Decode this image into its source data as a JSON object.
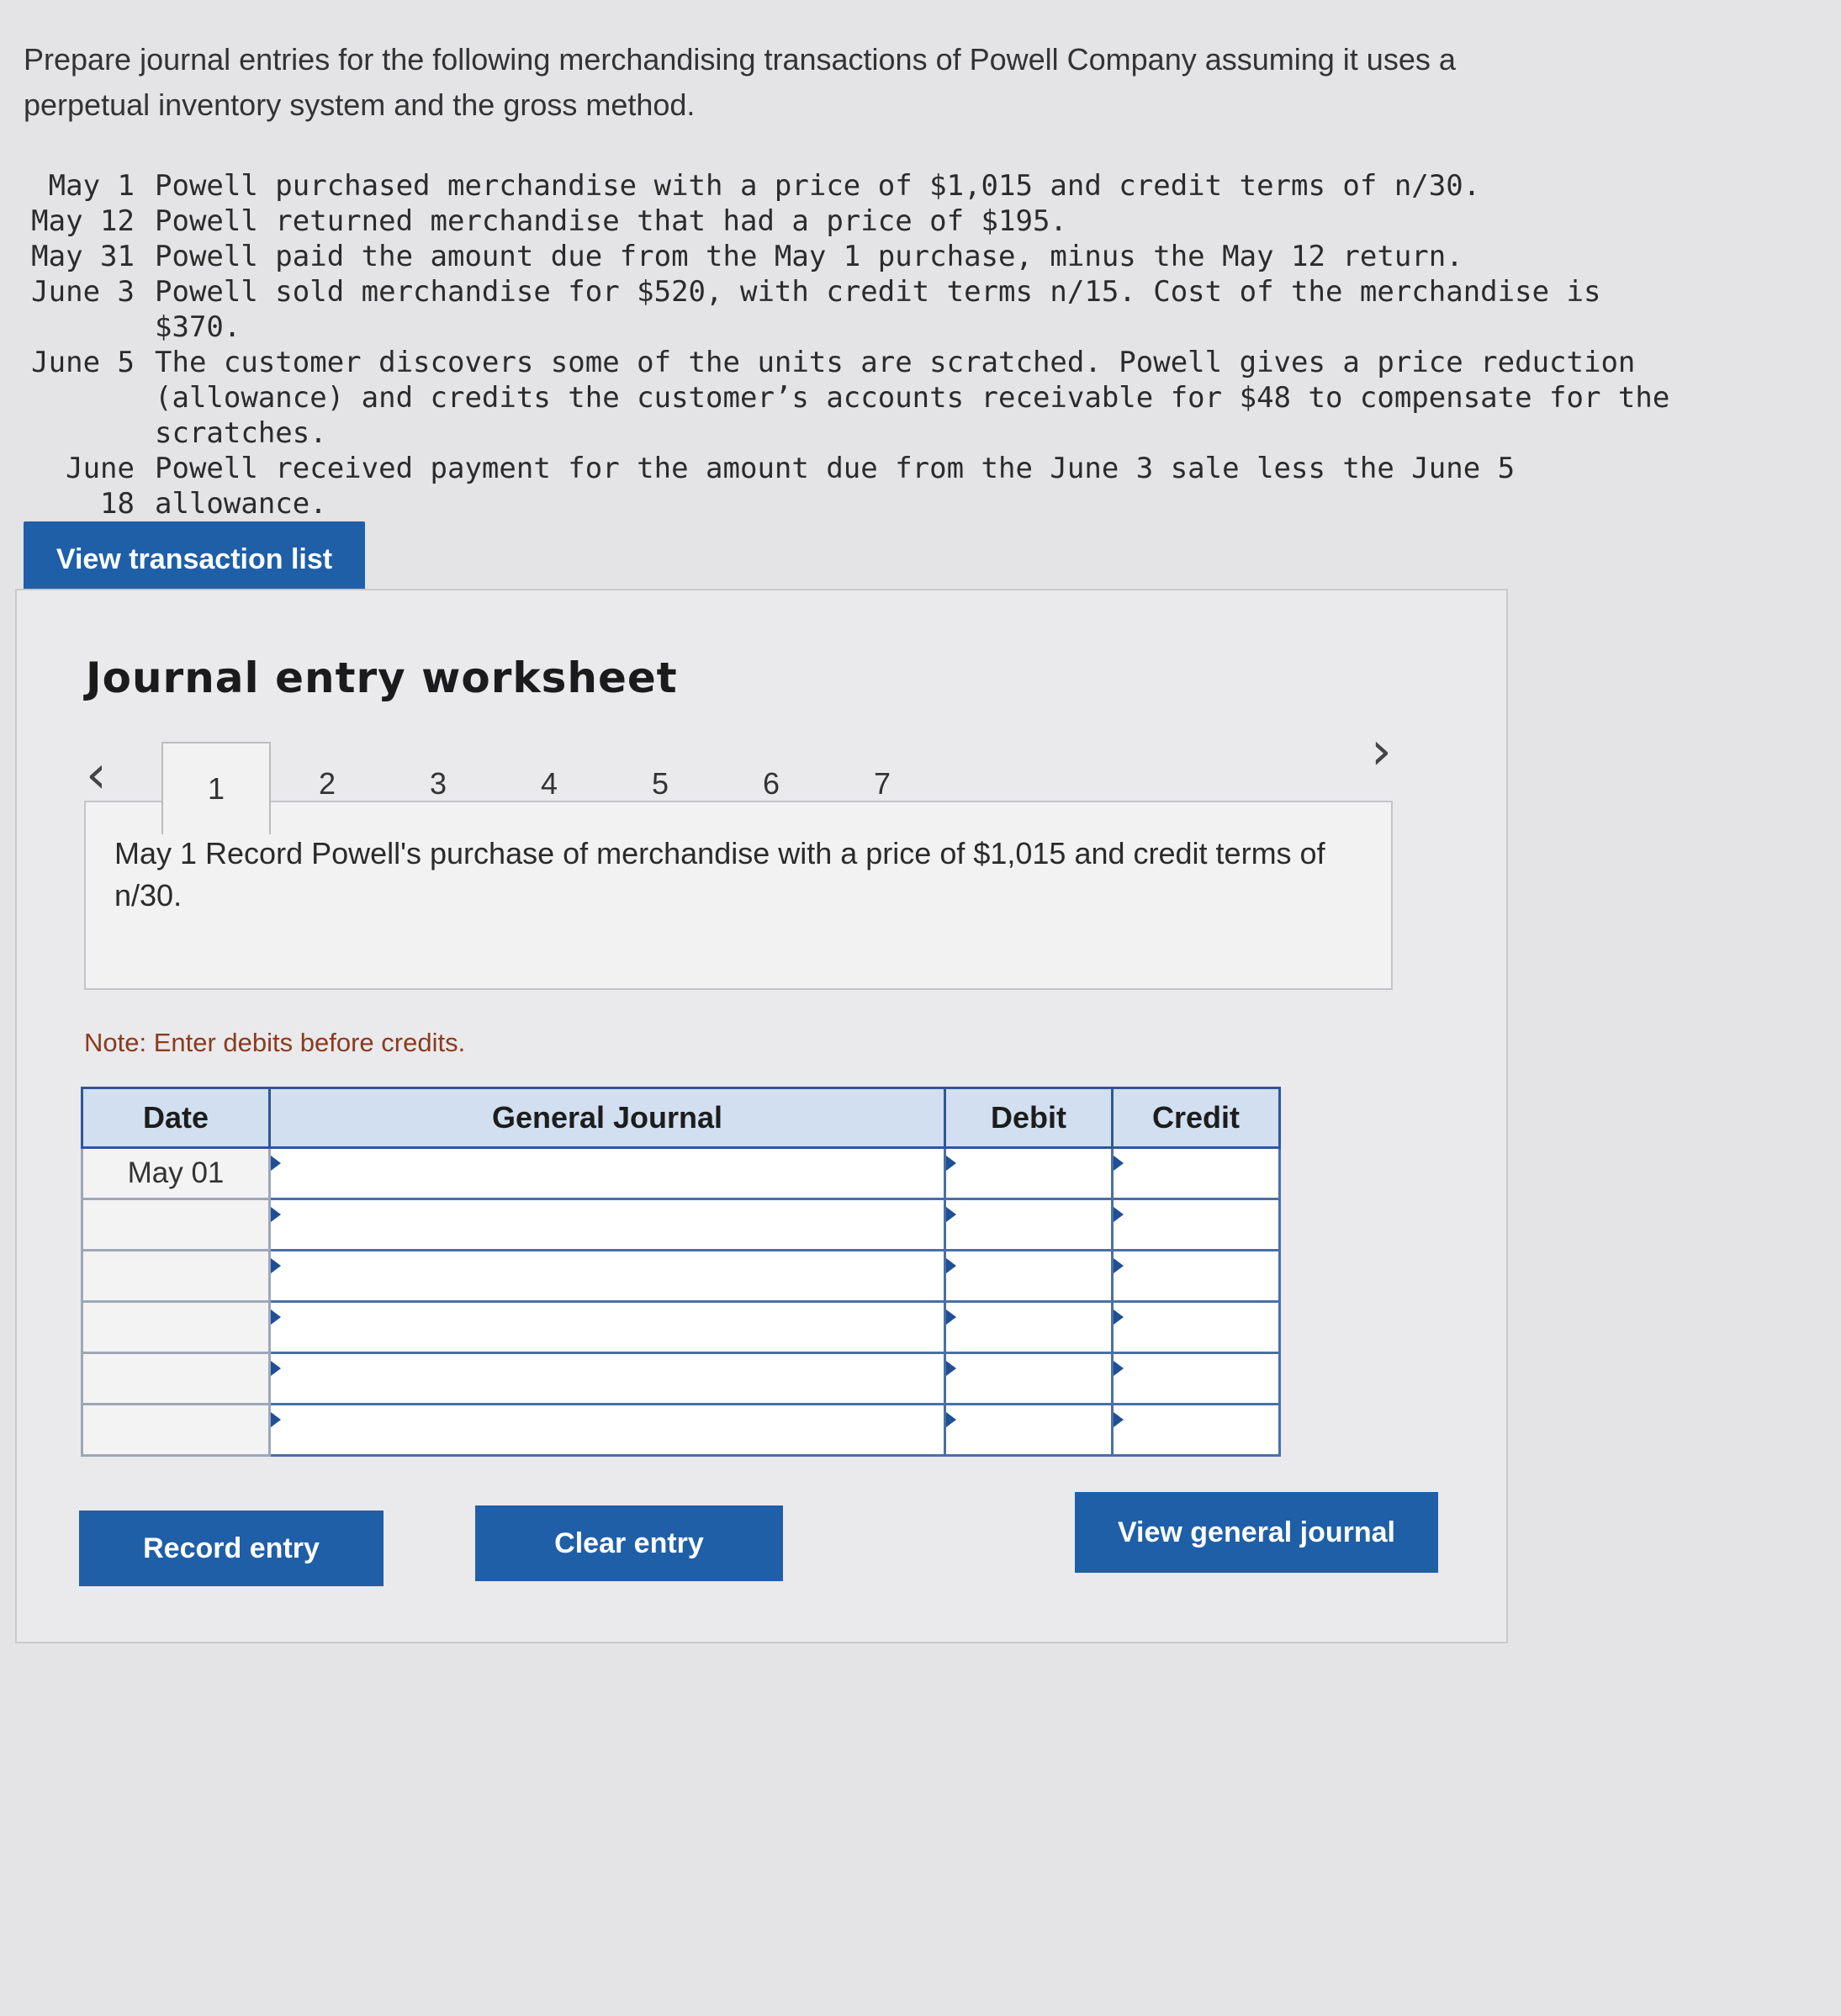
{
  "intro": {
    "line1": "Prepare journal entries for the following merchandising transactions of Powell Company assuming it uses a",
    "line2": "perpetual inventory system and the gross method."
  },
  "transactions": [
    {
      "date": "May 1",
      "text": "Powell purchased merchandise with a price of $1,015 and credit terms of n/30."
    },
    {
      "date": "May 12",
      "text": "Powell returned merchandise that had a price of $195."
    },
    {
      "date": "May 31",
      "text": "Powell paid the amount due from the May 1 purchase, minus the May 12 return."
    },
    {
      "date": "June 3",
      "text": "Powell sold merchandise for $520, with credit terms n/15. Cost of the merchandise is $370."
    },
    {
      "date": "June 5",
      "text": "The customer discovers some of the units are scratched. Powell gives a price reduction (allowance) and credits the customer’s accounts receivable for $48 to compensate for the scratches."
    },
    {
      "date": "June 18",
      "text": "Powell received payment for the amount due from the June 3 sale less the June 5 allowance."
    }
  ],
  "buttons": {
    "view_transaction_list": "View transaction list",
    "record_entry": "Record entry",
    "clear_entry": "Clear entry",
    "view_general_journal": "View general journal"
  },
  "worksheet": {
    "title": "Journal entry worksheet",
    "prev_icon": "chevron-left-icon",
    "next_icon": "chevron-right-icon",
    "tabs": [
      "1",
      "2",
      "3",
      "4",
      "5",
      "6",
      "7"
    ],
    "active_tab": "1",
    "prompt": "May 1 Record Powell's purchase of merchandise with a price of $1,015 and credit terms of n/30.",
    "note": "Note: Enter debits before credits."
  },
  "journal": {
    "headers": {
      "date": "Date",
      "general_journal": "General Journal",
      "debit": "Debit",
      "credit": "Credit"
    },
    "rows": [
      {
        "date": "May 01",
        "account": "",
        "debit": "",
        "credit": ""
      },
      {
        "date": "",
        "account": "",
        "debit": "",
        "credit": ""
      },
      {
        "date": "",
        "account": "",
        "debit": "",
        "credit": ""
      },
      {
        "date": "",
        "account": "",
        "debit": "",
        "credit": ""
      },
      {
        "date": "",
        "account": "",
        "debit": "",
        "credit": ""
      },
      {
        "date": "",
        "account": "",
        "debit": "",
        "credit": ""
      }
    ]
  },
  "colors": {
    "button_blue": "#1f5fa8",
    "header_bg": "#d2dff0",
    "note_text": "#8a3b1e"
  }
}
